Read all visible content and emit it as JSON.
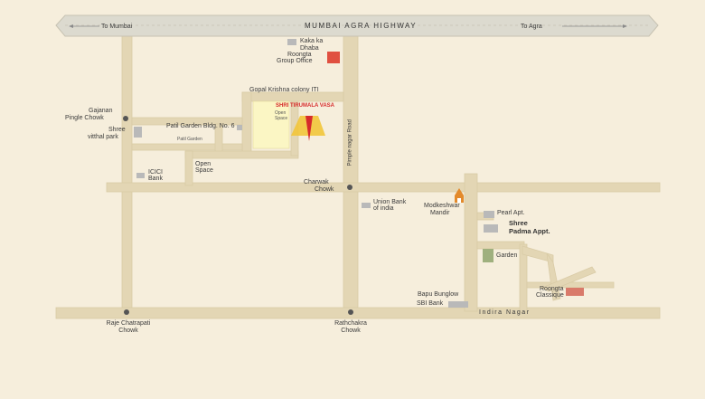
{
  "map": {
    "highway": {
      "title": "MUMBAI AGRA HIGHWAY",
      "left": "To Mumbai",
      "right": "To Agra"
    },
    "roads": {
      "pimple_nagar": "Pimple nagar Road",
      "indira_nagar": "Indira Nagar"
    },
    "project": {
      "name": "SHRI TIRUMALA VASA",
      "open_space": "Open Space"
    },
    "landmarks": {
      "kaka_dhaba_1": "Kaka ka",
      "kaka_dhaba_2": "Dhaba",
      "roongta_office_1": "Roongta",
      "roongta_office_2": "Group Office",
      "gopal_krishna": "Gopal Krishna colony ITI",
      "gajanan_1": "Gajanan",
      "gajanan_2": "Pingle Chowk",
      "patil_bldg": "Patil Garden Bldg. No. 6",
      "shree_vitthal_1": "Shree",
      "shree_vitthal_2": "vitthal park",
      "patil_garden": "Patil Garden",
      "open_space_1": "Open",
      "open_space_2": "Space",
      "icici_1": "ICICI",
      "icici_2": "Bank",
      "charwak_1": "Charwak",
      "charwak_2": "Chowk",
      "union_1": "Union Bank",
      "union_2": "of india",
      "modkeshwar_1": "Modkeshwar",
      "modkeshwar_2": "Mandir",
      "pearl": "Pearl Apt.",
      "padma_1": "Shree",
      "padma_2": "Padma Appt.",
      "garden": "Garden",
      "bapu": "Bapu Bunglow",
      "sbi": "SBI Bank",
      "roongta_classique_1": "Roongta",
      "roongta_classique_2": "Classique",
      "raje_1": "Raje Chatrapati",
      "raje_2": "Chowk",
      "rathchakra_1": "Rathchakra",
      "rathchakra_2": "Chowk"
    },
    "colors": {
      "background": "#f6eedc",
      "road": "#e3d6b4",
      "highway": "#dcdacf",
      "building": "#b9b9b9",
      "highlight": "#e05040",
      "project_area": "#fbf6c4",
      "project_marker": "#f2c53a",
      "label_red": "#d62b2b"
    }
  }
}
